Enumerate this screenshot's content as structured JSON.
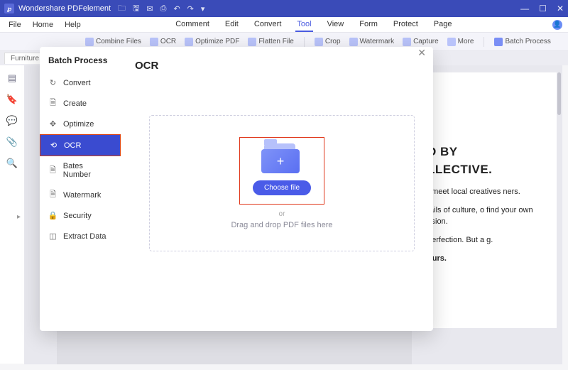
{
  "titlebar": {
    "app_name": "Wondershare PDFelement",
    "window_controls": {
      "min": "—",
      "max": "☐",
      "close": "✕"
    }
  },
  "menubar": {
    "left": [
      "File",
      "Home",
      "Help"
    ],
    "center": [
      "Comment",
      "Edit",
      "Convert",
      "Tool",
      "View",
      "Form",
      "Protect",
      "Page"
    ],
    "active": "Tool"
  },
  "toolbar": {
    "items": [
      "Combine Files",
      "OCR",
      "Optimize PDF",
      "Flatten File",
      "Crop",
      "Watermark",
      "Capture",
      "More"
    ],
    "batch": "Batch Process"
  },
  "tab": {
    "label": "Furniture.pdf"
  },
  "doc_preview": {
    "heading_l1": "D BY",
    "heading_l2": "LLECTIVE.",
    "p1": ", meet local creatives ners.",
    "p2": "tails of culture, o find your own ssion.",
    "p3": "perfection. But a g.",
    "p4": "ours."
  },
  "modal": {
    "title": "Batch Process",
    "main_title": "OCR",
    "close": "✕",
    "sidebar": [
      {
        "icon": "↻",
        "label": "Convert"
      },
      {
        "icon": "🗎",
        "label": "Create"
      },
      {
        "icon": "✥",
        "label": "Optimize"
      },
      {
        "icon": "⟲",
        "label": "OCR"
      },
      {
        "icon": "🗎",
        "label": "Bates Number"
      },
      {
        "icon": "🗎",
        "label": "Watermark"
      },
      {
        "icon": "🔒",
        "label": "Security"
      },
      {
        "icon": "◫",
        "label": "Extract Data"
      }
    ],
    "active_index": 3,
    "choose_file": "Choose file",
    "or": "or",
    "drag_text": "Drag and drop PDF files here"
  },
  "colors": {
    "accent": "#4a5be8",
    "titlebar": "#3a4bb8",
    "highlight_border": "#e0371a"
  }
}
